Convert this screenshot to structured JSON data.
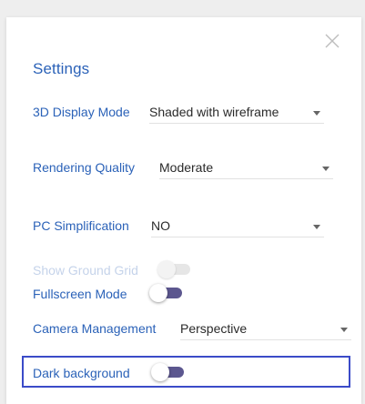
{
  "settings": {
    "title": "Settings",
    "display_mode": {
      "label": "3D Display Mode",
      "value": "Shaded with wireframe"
    },
    "rendering_quality": {
      "label": "Rendering Quality",
      "value": "Moderate"
    },
    "pc_simplification": {
      "label": "PC Simplification",
      "value": "NO"
    },
    "show_ground_grid": {
      "label": "Show Ground Grid",
      "enabled": false,
      "on": false
    },
    "fullscreen_mode": {
      "label": "Fullscreen Mode",
      "on": false
    },
    "camera_management": {
      "label": "Camera Management",
      "value": "Perspective"
    },
    "dark_background": {
      "label": "Dark background",
      "on": false
    }
  },
  "icons": {
    "close": "close-icon",
    "dropdown": "caret-down-icon"
  },
  "colors": {
    "accent": "#2b62b8",
    "toggle_track": "#5c578f",
    "highlight_border": "#3b4bc8",
    "disabled_text": "#c5d3ea"
  }
}
